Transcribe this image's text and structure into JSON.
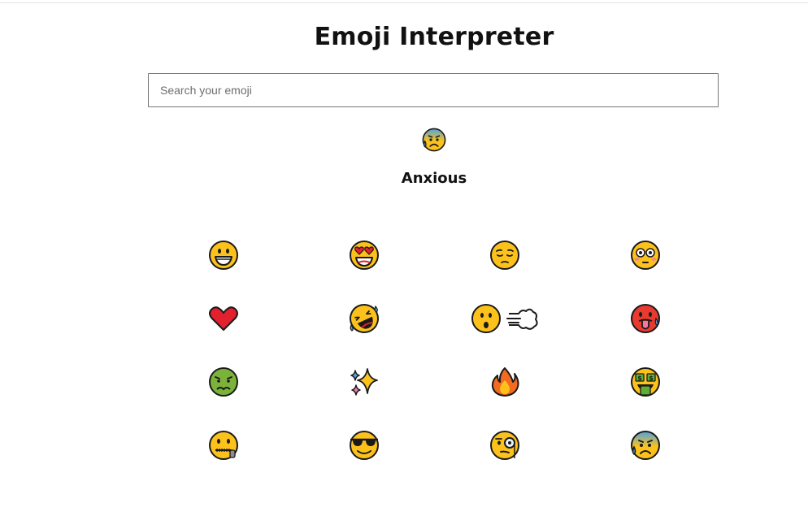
{
  "app": {
    "title": "Emoji Interpreter"
  },
  "search": {
    "placeholder": "Search your emoji",
    "value": ""
  },
  "result": {
    "emoji_icon": "anxious-face-with-sweat-icon",
    "meaning": "Anxious"
  },
  "emoji_grid": [
    {
      "icon": "grinning-face-icon"
    },
    {
      "icon": "smiling-face-with-heart-eyes-icon"
    },
    {
      "icon": "pensive-face-icon"
    },
    {
      "icon": "flushed-face-icon"
    },
    {
      "icon": "red-heart-icon"
    },
    {
      "icon": "rolling-on-the-floor-laughing-icon"
    },
    {
      "icon": "face-exhaling-icon"
    },
    {
      "icon": "hot-face-icon"
    },
    {
      "icon": "nauseated-face-icon"
    },
    {
      "icon": "sparkles-icon"
    },
    {
      "icon": "fire-icon"
    },
    {
      "icon": "money-mouth-face-icon"
    },
    {
      "icon": "zipper-mouth-face-icon"
    },
    {
      "icon": "smiling-face-with-sunglasses-icon"
    },
    {
      "icon": "face-with-monocle-icon"
    },
    {
      "icon": "anxious-face-with-sweat-icon"
    }
  ],
  "colors": {
    "face_yellow": "#FCC21B",
    "outline": "#1a1a1a",
    "heart_red": "#E2202E",
    "hot_red": "#E83A2E",
    "nauseated_green": "#7BB33A",
    "anxious_blue": "#4FA3E0"
  }
}
